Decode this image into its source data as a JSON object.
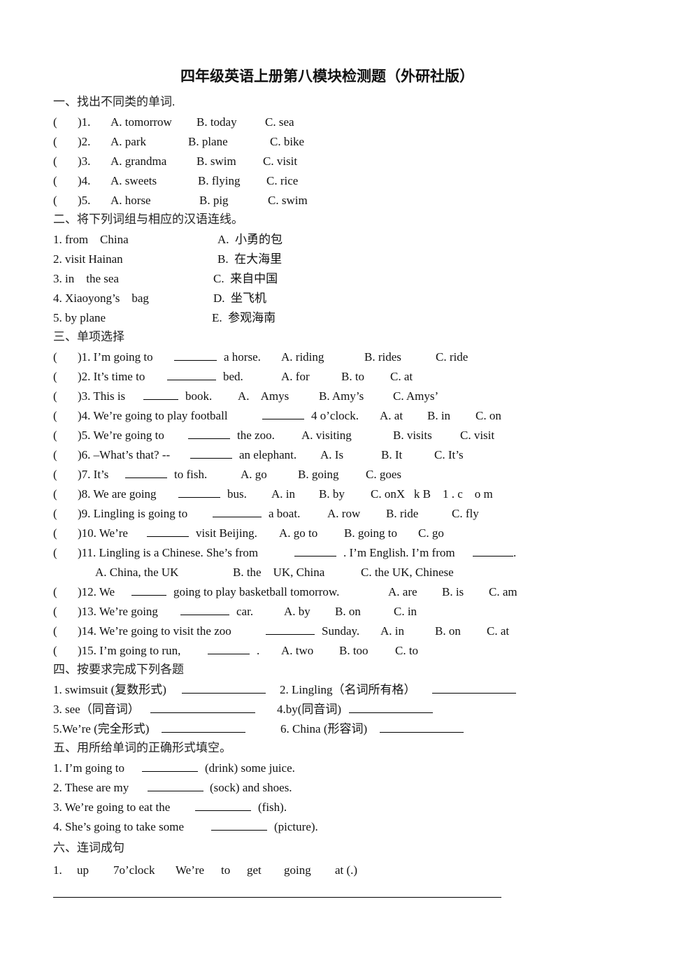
{
  "title": "四年级英语上册第八模块检测题（外研社版）",
  "section1": {
    "heading": "一、找出不同类的单词.",
    "items": [
      {
        "paren": "(",
        "num": ")1.",
        "a": "A. tomorrow",
        "b": "B. today",
        "c": "C. sea"
      },
      {
        "paren": "(",
        "num": ")2.",
        "a": "A. park",
        "b": "B. plane",
        "c": "C. bike"
      },
      {
        "paren": "(",
        "num": ")3.",
        "a": "A. grandma",
        "b": "B. swim",
        "c": "C. visit"
      },
      {
        "paren": "(",
        "num": ")4.",
        "a": "A. sweets",
        "b": "B. flying",
        "c": "C. rice"
      },
      {
        "paren": "(",
        "num": ")5.",
        "a": "A. horse",
        "b": "B. pig",
        "c": "C. swim"
      }
    ]
  },
  "section2": {
    "heading": "二、将下列词组与相应的汉语连线。",
    "left": [
      "1. from    China",
      "2. visit Hainan",
      "3. in    the sea",
      "4. Xiaoyong’s    bag",
      "5. by plane"
    ],
    "right": [
      "A.  小勇的包",
      "B.  在大海里",
      "C.  来自中国",
      "D.  坐飞机",
      "E.  参观海南"
    ]
  },
  "section3": {
    "heading": "三、单项选择",
    "items": [
      {
        "pre": ")1. I’m going to",
        "post": "a horse.",
        "a": "A. riding",
        "b": "B. rides",
        "c": "C. ride"
      },
      {
        "pre": ")2. It’s time to",
        "post": "bed.",
        "a": "A. for",
        "b": "B. to",
        "c": "C. at"
      },
      {
        "pre": ")3. This is",
        "post": "book.",
        "a": "A.    Amys",
        "b": "B. Amy’s",
        "c": "C. Amys’"
      },
      {
        "pre": ")4. We’re going to play football",
        "post": "4 o’clock.",
        "a": "A. at",
        "b": "B. in",
        "c": "C. on"
      },
      {
        "pre": ")5. We’re going to",
        "post": "the zoo.",
        "a": "A. visiting",
        "b": "B. visits",
        "c": "C. visit"
      },
      {
        "pre": ")6. –What’s that? --",
        "post": "an elephant.",
        "a": "A. Is",
        "b": "B. It",
        "c": "C. It’s"
      },
      {
        "pre": ")7. It’s",
        "post": "to fish.",
        "a": "A. go",
        "b": "B. going",
        "c": "C. goes"
      },
      {
        "pre": ")8. We are going",
        "post": "bus.",
        "a": "A. in",
        "b": "B. by",
        "c": "C. onX   k B    1 . c    o m"
      },
      {
        "pre": ")9. Lingling is going to",
        "post": "a boat.",
        "a": "A. row",
        "b": "B. ride",
        "c": "C. fly"
      },
      {
        "pre": ")10. We’re",
        "post": "visit Beijing.",
        "a": "A. go to",
        "b": "B. going to",
        "c": "C. go"
      },
      {
        "pre": ")11. Lingling is a Chinese. She’s from",
        "post": ". I’m English. I’m from",
        "tail": ".",
        "a": "A. China, the UK",
        "b": "B. the    UK, China",
        "c": "C. the UK, Chinese"
      },
      {
        "pre": ")12. We",
        "post": "going to play basketball tomorrow.",
        "a": "A. are",
        "b": "B. is",
        "c": "C. am"
      },
      {
        "pre": ")13. We’re going",
        "post": "car.",
        "a": "A. by",
        "b": "B. on",
        "c": "C. in"
      },
      {
        "pre": ")14. We’re going to visit the zoo",
        "post": "Sunday.",
        "a": "A. in",
        "b": "B. on",
        "c": "C. at"
      },
      {
        "pre": ")15. I’m going to run,",
        "post": ".",
        "a": "A. two",
        "b": "B. too",
        "c": "C. to"
      }
    ]
  },
  "section4": {
    "heading": "四、按要求完成下列各题",
    "items": [
      "1. swimsuit (复数形式)",
      "2. Lingling（名词所有格）",
      "3. see（同音词）",
      "4.by(同音词)",
      "5.We’re (完全形式)",
      "6. China (形容词)"
    ]
  },
  "section5": {
    "heading": "五、用所给单词的正确形式填空。",
    "items": [
      {
        "pre": "1. I’m going to",
        "post": "(drink) some juice."
      },
      {
        "pre": "2. These are my",
        "post": "(sock) and shoes."
      },
      {
        "pre": "3. We’re going to eat the",
        "post": "(fish)."
      },
      {
        "pre": "4. She’s going to take some",
        "post": "(picture)."
      }
    ]
  },
  "section6": {
    "heading": "六、连词成句",
    "items": [
      {
        "num": "1.",
        "words": [
          "up",
          "7o’clock",
          "We’re",
          "to",
          "get",
          "going",
          "at (.)"
        ]
      }
    ]
  }
}
